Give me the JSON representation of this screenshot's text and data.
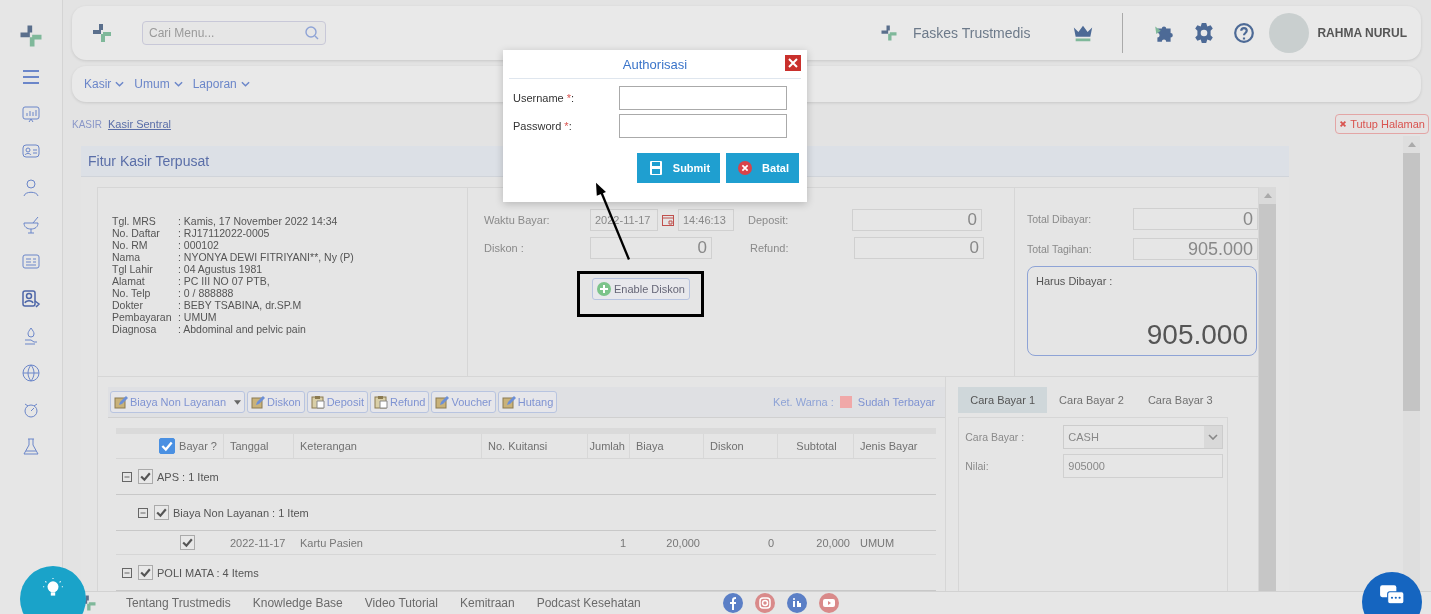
{
  "header": {
    "search": {
      "placeholder": "Cari Menu..."
    },
    "facility": "Faskes Trustmedis",
    "user": "RAHMA NURUL"
  },
  "menu": [
    {
      "label": "Kasir"
    },
    {
      "label": "Umum"
    },
    {
      "label": "Laporan"
    }
  ],
  "breadcrumb": {
    "section": "KASIR",
    "current": "Kasir Sentral"
  },
  "close_page": "Tutup Halaman",
  "panel_title": "Fitur Kasir Terpusat",
  "patient": [
    {
      "label": "Tgl. MRS",
      "value": ": Kamis, 17 November 2022 14:34"
    },
    {
      "label": "No. Daftar",
      "value": ": RJ17112022-0005"
    },
    {
      "label": "No. RM",
      "value": ": 000102"
    },
    {
      "label": "Nama",
      "value": ": NYONYA DEWI FITRIYANI**, Ny (P)"
    },
    {
      "label": "Tgl Lahir",
      "value": ": 04 Agustus 1981"
    },
    {
      "label": "Alamat",
      "value": ": PC III NO 07 PTB,"
    },
    {
      "label": "No. Telp",
      "value": ": 0 / 888888"
    },
    {
      "label": "Dokter",
      "value": ": BEBY TSABINA, dr.SP.M"
    },
    {
      "label": "Pembayaran",
      "value": ": UMUM"
    },
    {
      "label": "Diagnosa",
      "value": ": Abdominal and pelvic pain"
    }
  ],
  "payment": {
    "waktu_label": "Waktu Bayar:",
    "date": "2022-11-17",
    "time": "14:46:13",
    "diskon_label": "Diskon :",
    "diskon": "0",
    "deposit_label": "Deposit:",
    "deposit": "0",
    "refund_label": "Refund:",
    "refund": "0",
    "enable_diskon": "Enable Diskon"
  },
  "totals": {
    "dibayar_label": "Total Dibayar:",
    "dibayar": "0",
    "tagihan_label": "Total Tagihan:",
    "tagihan": "905.000",
    "harus_label": "Harus Dibayar :",
    "harus": "905.000"
  },
  "toolbar": [
    {
      "label": "Biaya Non Layanan",
      "kind": "edit",
      "dropdown": true
    },
    {
      "label": "Diskon",
      "kind": "edit",
      "dropdown": false
    },
    {
      "label": "Deposit",
      "kind": "paste",
      "dropdown": false
    },
    {
      "label": "Refund",
      "kind": "paste",
      "dropdown": false
    },
    {
      "label": "Voucher",
      "kind": "edit",
      "dropdown": false
    },
    {
      "label": "Hutang",
      "kind": "edit",
      "dropdown": false
    }
  ],
  "legend": {
    "label": "Ket. Warna :",
    "items": [
      {
        "label": "Sudah Terbayar",
        "color": "#f0a8a8"
      }
    ]
  },
  "table": {
    "all_checked": true,
    "columns": [
      "Bayar ?",
      "Tanggal",
      "Keterangan",
      "No. Kuitansi",
      "Jumlah",
      "Biaya",
      "Diskon",
      "Subtotal",
      "Jenis Bayar"
    ],
    "rows": [
      {
        "kind": "group",
        "label": "APS : 1 Item",
        "checked": true,
        "expanded": true,
        "children": [
          {
            "kind": "group",
            "label": "Biaya Non Layanan : 1 Item",
            "checked": true,
            "expanded": true,
            "children": [
              {
                "kind": "item",
                "checked": true,
                "tanggal": "2022-11-17",
                "keterangan": "Kartu Pasien",
                "jumlah": "1",
                "biaya": "20,000",
                "diskon": "0",
                "subtotal": "20,000",
                "jenis_bayar": "UMUM"
              }
            ]
          }
        ]
      },
      {
        "kind": "group",
        "label": "POLI MATA : 4 Items",
        "checked": true,
        "expanded": true
      }
    ]
  },
  "pay_tabs": [
    {
      "label": "Cara Bayar 1",
      "selected": true
    },
    {
      "label": "Cara Bayar 2",
      "selected": false
    },
    {
      "label": "Cara Bayar 3",
      "selected": false
    }
  ],
  "pay_method": {
    "cara_label": "Cara Bayar :",
    "cara": "CASH",
    "nilai_label": "Nilai:",
    "nilai": "905000"
  },
  "footer": {
    "links": [
      "Tentang Trustmedis",
      "Knowledge Base",
      "Video Tutorial",
      "Kemitraan",
      "Podcast Kesehatan"
    ]
  },
  "modal": {
    "title": "Authorisasi",
    "fields": [
      {
        "label": "Username",
        "required": "*",
        "suffix": ":"
      },
      {
        "label": "Password",
        "required": "*",
        "suffix": ":"
      }
    ],
    "buttons": [
      {
        "label": "Submit",
        "kind": "save"
      },
      {
        "label": "Batal",
        "kind": "cancel"
      }
    ]
  }
}
